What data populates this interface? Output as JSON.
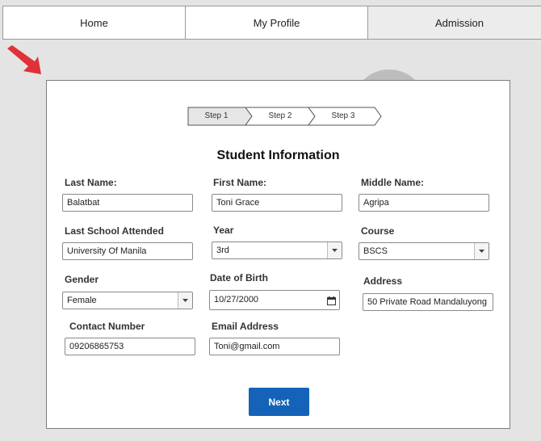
{
  "nav": {
    "tabs": [
      {
        "label": "Home"
      },
      {
        "label": "My Profile"
      },
      {
        "label": "Admission"
      }
    ]
  },
  "steps": [
    "Step 1",
    "Step 2",
    "Step 3"
  ],
  "form": {
    "title": "Student Information",
    "last_name": {
      "label": "Last Name:",
      "value": "Balatbat"
    },
    "first_name": {
      "label": "First Name:",
      "value": "Toni Grace"
    },
    "middle_name": {
      "label": "Middle Name:",
      "value": "Agripa"
    },
    "last_school": {
      "label": "Last School Attended",
      "value": "University Of Manila"
    },
    "year": {
      "label": "Year",
      "value": "3rd"
    },
    "course": {
      "label": "Course",
      "value": "BSCS"
    },
    "gender": {
      "label": "Gender",
      "value": "Female"
    },
    "dob": {
      "label": "Date of Birth",
      "value": "10/27/2000"
    },
    "address": {
      "label": "Address",
      "value": "50 Private Road Mandaluyong"
    },
    "contact": {
      "label": "Contact Number",
      "value": "09206865753"
    },
    "email": {
      "label": "Email Address",
      "value": "Toni@gmail.com"
    },
    "next_label": "Next"
  },
  "colors": {
    "accent": "#1463b8",
    "arrow": "#e0303a"
  }
}
